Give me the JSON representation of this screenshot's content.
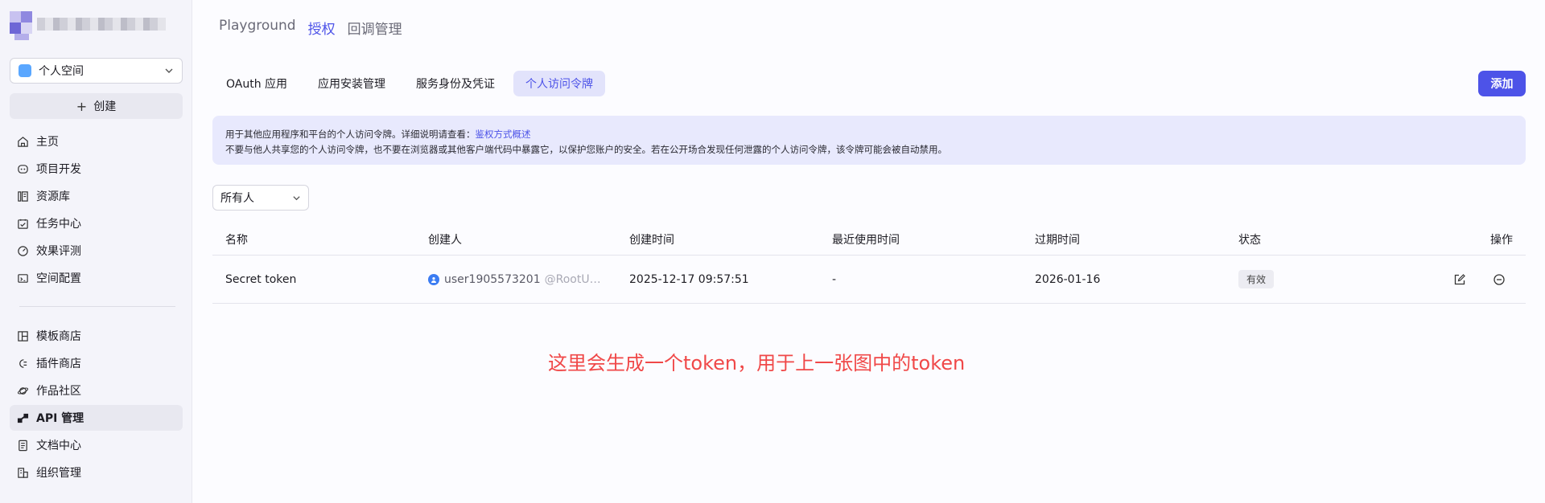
{
  "sidebar": {
    "space_selector": {
      "value": "个人空间"
    },
    "create_label": "创建",
    "nav_primary": [
      {
        "label": "主页",
        "icon": "home-icon"
      },
      {
        "label": "项目开发",
        "icon": "bot-icon"
      },
      {
        "label": "资源库",
        "icon": "library-icon"
      },
      {
        "label": "任务中心",
        "icon": "task-icon"
      },
      {
        "label": "效果评测",
        "icon": "gauge-icon"
      },
      {
        "label": "空间配置",
        "icon": "config-icon"
      }
    ],
    "nav_secondary": [
      {
        "label": "模板商店",
        "icon": "template-icon"
      },
      {
        "label": "插件商店",
        "icon": "plugin-icon"
      },
      {
        "label": "作品社区",
        "icon": "planet-icon"
      },
      {
        "label": "API 管理",
        "icon": "api-icon",
        "active": true
      },
      {
        "label": "文档中心",
        "icon": "doc-icon"
      },
      {
        "label": "组织管理",
        "icon": "org-icon"
      }
    ]
  },
  "top_nav": {
    "items": [
      "Playground",
      "授权",
      "回调管理"
    ],
    "active_index": 1
  },
  "tabs": {
    "items": [
      "OAuth 应用",
      "应用安装管理",
      "服务身份及凭证",
      "个人访问令牌"
    ],
    "active_index": 3
  },
  "add_button": "添加",
  "notice": {
    "line1_prefix": "用于其他应用程序和平台的个人访问令牌。详细说明请查看：",
    "line1_link": "鉴权方式概述",
    "line2": "不要与他人共享您的个人访问令牌，也不要在浏览器或其他客户端代码中暴露它，以保护您账户的安全。若在公开场合发现任何泄露的个人访问令牌，该令牌可能会被自动禁用。"
  },
  "filter": {
    "owner_value": "所有人"
  },
  "table": {
    "headers": {
      "name": "名称",
      "creator": "创建人",
      "created_at": "创建时间",
      "last_used": "最近使用时间",
      "expires_at": "过期时间",
      "status": "状态",
      "actions": "操作"
    },
    "rows": [
      {
        "name": "Secret token",
        "creator_name": "user1905573201",
        "creator_handle": "@RootUser…",
        "created_at": "2025-12-17 09:57:51",
        "last_used": "-",
        "expires_at": "2026-01-16",
        "status": "有效"
      }
    ]
  },
  "annotation": "这里会生成一个token，用于上一张图中的token",
  "colors": {
    "accent": "#4d53e8",
    "annotation_red": "#f04848",
    "notice_bg": "#e8e9fd"
  }
}
